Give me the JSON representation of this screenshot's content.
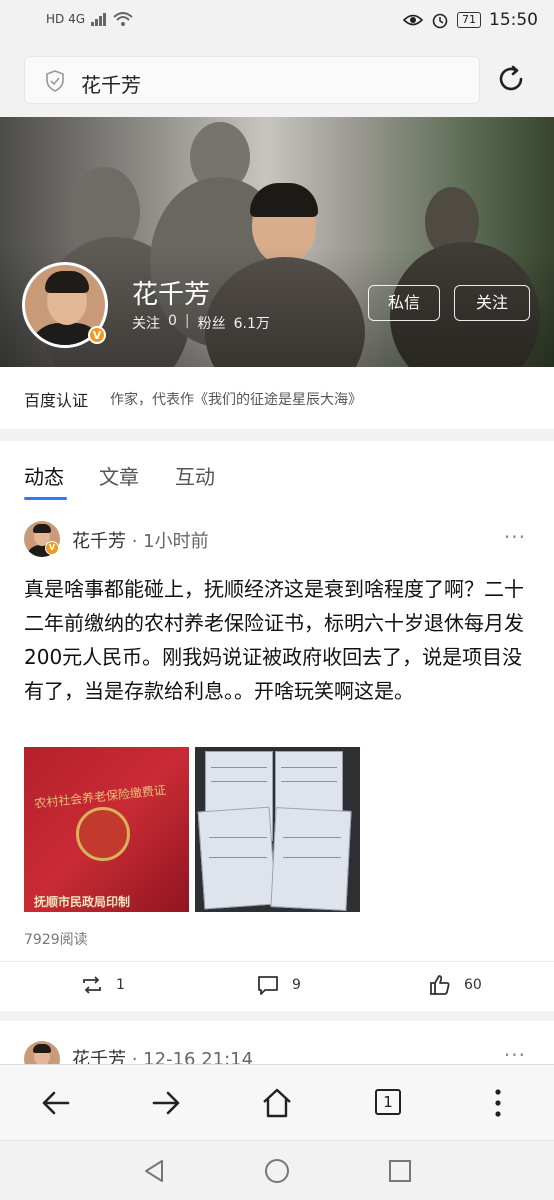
{
  "status_bar": {
    "network": "HD 4G",
    "battery": "71",
    "time": "15:50"
  },
  "search": {
    "query": "花千芳"
  },
  "profile": {
    "name": "花千芳",
    "follow_label": "关注",
    "follow_count": "0",
    "separator": "|",
    "fans_label": "粉丝",
    "fans_count": "6.1万",
    "message_button": "私信",
    "follow_button": "关注",
    "verified_badge": "V"
  },
  "certification": {
    "label": "百度认证",
    "text": "作家，代表作《我们的征途是星辰大海》"
  },
  "tabs": [
    {
      "label": "动态"
    },
    {
      "label": "文章"
    },
    {
      "label": "互动"
    }
  ],
  "post": {
    "author": "花千芳",
    "time": " · 1小时前",
    "more": "···",
    "body": "真是啥事都能碰上，抚顺经济这是衰到啥程度了啊？二十二年前缴纳的农村养老保险证书，标明六十岁退休每月发200元人民币。刚我妈说证被政府收回去了，说是项目没有了，当是存款给利息。。开啥玩笑啊这是。",
    "image1_text_top": "农村社会养老保险缴费证",
    "image1_text_bottom": "抚顺市民政局印制",
    "reads": "7929阅读",
    "reposts": "1",
    "comments": "9",
    "likes": "60"
  },
  "post2": {
    "author": "花千芳",
    "time": " · 12-16 21:14",
    "more": "···"
  },
  "browser": {
    "tab_count": "1"
  },
  "icons": {
    "search_field": "shield-icon",
    "refresh": "refresh-icon",
    "repost": "repost-icon",
    "comment": "comment-icon",
    "like": "like-icon",
    "back": "back-arrow-icon",
    "forward": "forward-arrow-icon",
    "home": "home-icon",
    "menu": "more-vertical-icon"
  },
  "colors": {
    "accent": "#3377ff",
    "badge": "#f29a1d"
  }
}
